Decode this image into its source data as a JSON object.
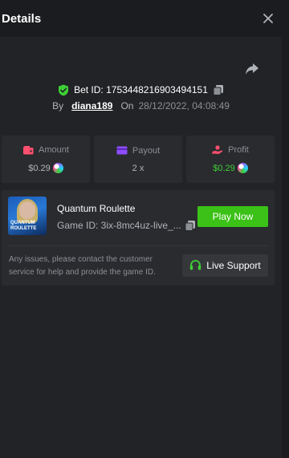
{
  "header": {
    "title": "Details"
  },
  "bet": {
    "id_label": "Bet ID: 1753448216903494151",
    "by_label": "By",
    "username": "diana189",
    "on_label": "On",
    "date": "28/12/2022, 04:08:49"
  },
  "stats": [
    {
      "label": "Amount",
      "value": "$0.29",
      "icon": "wallet-icon",
      "icon_color": "#ff4f6e"
    },
    {
      "label": "Payout",
      "value": "2 x",
      "icon": "card-icon",
      "icon_color": "#8e4dff"
    },
    {
      "label": "Profit",
      "value": "$0.29",
      "icon": "hand-coin-icon",
      "icon_color": "#ff4f6e",
      "value_color": "#3ecf36"
    }
  ],
  "game": {
    "name": "Quantum Roulette",
    "id_label": "Game ID: 3ix-8mc4uz-live_...",
    "thumb_text": "QUANTUM ROULETTE",
    "play_label": "Play Now",
    "help_text": "Any issues, please contact the customer service for help and provide the game ID.",
    "support_label": "Live Support"
  },
  "colors": {
    "accent_green": "#3bc117",
    "shield_green": "#3ecf36",
    "background": "#222326"
  }
}
